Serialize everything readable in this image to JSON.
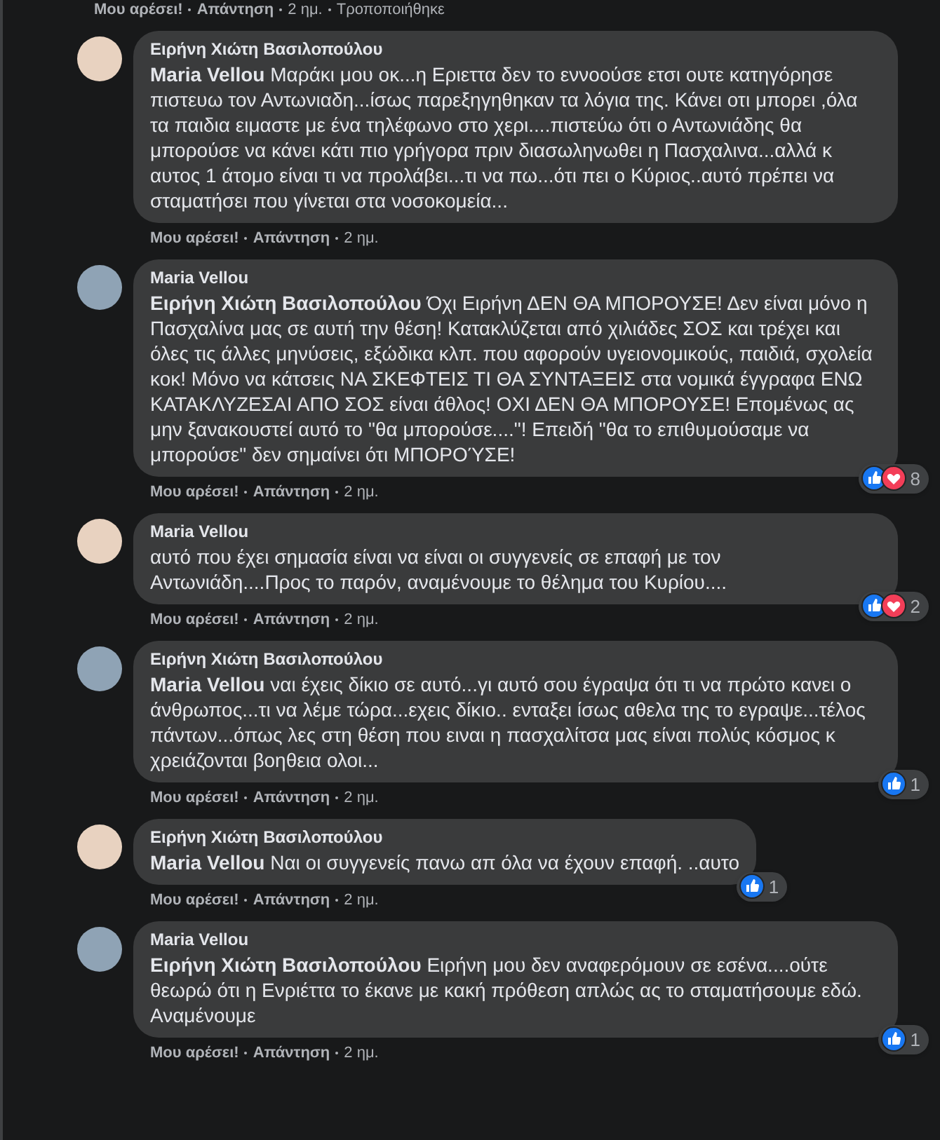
{
  "top_actions": {
    "like": "Μου αρέσει!",
    "reply": "Απάντηση",
    "time": "2 ημ.",
    "edited": "Τροποποιήθηκε"
  },
  "comments": [
    {
      "author": "Ειρήνη Χιώτη Βασιλοπούλου",
      "mention": "Maria Vellou",
      "text": "Μαράκι μου οκ...η Εριεττα δεν το εννοούσε ετσι ουτε κατηγόρησε πιστευω τον Αντωνιαδη...ίσως παρεξηγηθηκαν τα λόγια της. Κάνει οτι μπορει ,όλα τα παιδια ειμαστε με ένα τηλέφωνο στο χερι....πιστεύω ότι ο Αντωνιάδης θα μπορούσε να κάνει κάτι πιο γρήγορα πριν διασωληνωθει η Πασχαλινα...αλλά κ αυτος 1 άτομο είναι τι να προλάβει...τι να πω...ότι πει ο Κύριος..αυτό πρέπει να σταματήσει που γίνεται στα νοσοκομεία...",
      "like": "Μου αρέσει!",
      "reply": "Απάντηση",
      "time": "2 ημ."
    },
    {
      "author": "Maria Vellou",
      "mention": "Ειρήνη Χιώτη Βασιλοπούλου",
      "text": "Όχι Ειρήνη ΔΕΝ ΘΑ ΜΠΟΡΟΥΣΕ! Δεν είναι μόνο η Πασχαλίνα μας σε αυτή την θέση! Κατακλύζεται από χιλιάδες ΣΟΣ και τρέχει και όλες τις άλλες μηνύσεις, εξώδικα κλπ. που αφορούν υγειονομικούς, παιδιά, σχολεία κοκ! Μόνο να κάτσεις ΝΑ ΣΚΕΦΤΕΙΣ ΤΙ ΘΑ ΣΥΝΤΑΞΕΙΣ στα νομικά έγγραφα ΕΝΩ ΚΑΤΑΚΛΥΖΕΣΑΙ ΑΠΟ ΣΟΣ είναι άθλος! ΟΧΙ ΔΕΝ ΘΑ ΜΠΟΡΟΥΣΕ! Επομένως ας μην ξανακουστεί αυτό το \"θα μπορούσε....\"! Επειδή \"θα το επιθυμούσαμε να μπορούσε\" δεν σημαίνει ότι ΜΠΟΡΟΎΣΕ!",
      "like": "Μου αρέσει!",
      "reply": "Απάντηση",
      "time": "2 ημ.",
      "reactions": [
        {
          "kind": "like"
        },
        {
          "kind": "love"
        }
      ],
      "reaction_count": "8"
    },
    {
      "author": "Maria Vellou",
      "text": "αυτό που έχει σημασία είναι να είναι οι συγγενείς σε επαφή με τον Αντωνιάδη....Προς το παρόν, αναμένουμε το θέλημα του Κυρίου....",
      "like": "Μου αρέσει!",
      "reply": "Απάντηση",
      "time": "2 ημ.",
      "reactions": [
        {
          "kind": "like"
        },
        {
          "kind": "love"
        }
      ],
      "reaction_count": "2"
    },
    {
      "author": "Ειρήνη Χιώτη Βασιλοπούλου",
      "mention": "Maria Vellou",
      "text": "ναι έχεις δίκιο σε αυτό...γι αυτό σου έγραψα ότι τι να πρώτο κανει ο άνθρωπος...τι να λέμε τώρα...εχεις δίκιο.. ενταξει ίσως αθελα της το εγραψε...τέλος πάντων...όπως λες στη θέση που ειναι η πασχαλίτσα μας είναι πολύς κόσμος κ χρειάζονται βοηθεια ολοι...",
      "like": "Μου αρέσει!",
      "reply": "Απάντηση",
      "time": "2 ημ.",
      "reactions": [
        {
          "kind": "like"
        }
      ],
      "reaction_count": "1"
    },
    {
      "author": "Ειρήνη Χιώτη Βασιλοπούλου",
      "mention": "Maria Vellou",
      "text": "Ναι οι συγγενείς πανω απ όλα να έχουν επαφή. ..αυτο",
      "like": "Μου αρέσει!",
      "reply": "Απάντηση",
      "time": "2 ημ.",
      "reactions": [
        {
          "kind": "like"
        }
      ],
      "reaction_count": "1"
    },
    {
      "author": "Maria Vellou",
      "mention": "Ειρήνη Χιώτη Βασιλοπούλου",
      "text": "Ειρήνη μου δεν αναφερόμουν σε εσένα....ούτε θεωρώ ότι η Ενριέττα το έκανε με κακή πρόθεση απλώς ας το σταματήσουμε εδώ. Αναμένουμε",
      "like": "Μου αρέσει!",
      "reply": "Απάντηση",
      "time": "2 ημ.",
      "reactions": [
        {
          "kind": "like"
        }
      ],
      "reaction_count": "1"
    }
  ]
}
